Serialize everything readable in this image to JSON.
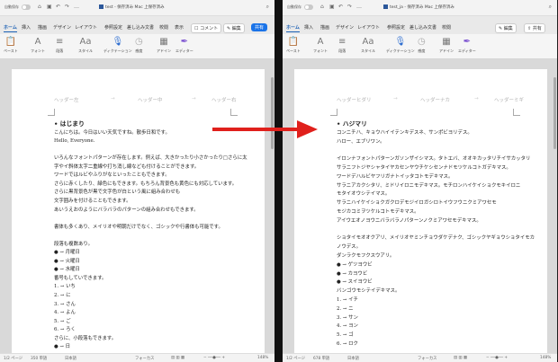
{
  "left_window": {
    "autosave": "自動保存",
    "title": "test - 保存済み Mac 上保存済み",
    "tabs": [
      "ホーム",
      "挿入",
      "描画",
      "デザイン",
      "レイアウト",
      "参照設定",
      "差し込み文書",
      "校閲",
      "表示"
    ],
    "tell_me": "操作アシスト",
    "comment": "コメント",
    "edit": "編集",
    "share": "共有",
    "ribbon": [
      "ペースト",
      "フォント",
      "段落",
      "スタイル",
      "ディクテーション",
      "感度",
      "アドイン",
      "エディター"
    ],
    "header": [
      "ヘッダー左",
      "ヘッダー中",
      "ヘッダー右"
    ],
    "lines": [
      "• はじまり",
      "こんにちは。今日はいい天気ですね。散歩日和です。",
      "Hello, Everyone.",
      "",
      "いろんなフォントパターンが存在します。例えば、大きかったり小さかったり□さらに太",
      "字やイ斜体太字二重線や打ち消し線なども付けることができます。",
      "ワードではルビやふりがなといったこともできます。",
      "さらに赤くしたり、緑色にもできます。もちろん背景色も黄色にも対応しています。",
      "さらに黒背景色が黒で文字色が白という風に組み合わせも",
      "文字囲みを付けることもできます。",
      "あいうえおのようにバラバラのパターンの組み合わせもできます。",
      "",
      "書体も多くあり、メイリオや明朝だけでなく、ゴシックや行書体も可能です。",
      "",
      "段落も複数あり。",
      "● → 月曜日",
      "● → 火曜日",
      "● → 水曜日",
      "番号もしていできます。",
      "1. → いち",
      "2. → に",
      "3. → さん",
      "4. → よん",
      "5. → ご",
      "6. → ろく",
      "さらに、小段落もできます。",
      "● → 日"
    ],
    "status": [
      "1/2 ページ",
      "350 単語",
      "日本語",
      "フォーカス",
      "148%"
    ]
  },
  "right_window": {
    "autosave": "自動保存",
    "title": "test_ja - 保存済み Mac 上保存済み",
    "tabs": [
      "ホーム",
      "挿入",
      "描画",
      "デザイン",
      "レイアウト",
      "参照設定",
      "差し込み文書",
      "校閲"
    ],
    "edit": "編集",
    "share": "共有",
    "ribbon": [
      "ペースト",
      "フォント",
      "段落",
      "スタイル",
      "ディクテーション",
      "感度",
      "アドイン",
      "エディター"
    ],
    "header": [
      "ヘッダーヒダリ",
      "ヘッダーナカ",
      "ヘッダーミギ"
    ],
    "lines": [
      "• ハジマリ",
      "コンニチハ、キョウハイイテンキデスネ、サンポビヨリデス。",
      "ハロー、エブリワン。",
      "",
      "イロンナフォントパターンガソンザイシマス。タトエバ、オオキカッタリチイサカッタリ",
      "サラニフトジヤシャタイヤカセンヤウチケシセンナドモツケルコトガデキマス。",
      "ワードデハルビヤフリガナトイッタコトモデキマス。",
      "サラニアカクシタリ、ミドリイロニモデキマス。モチロンハイケイショクモキイロニ",
      "モタイオウシテイマス。",
      "サラニハイケイショクガクロデモジイロガシロトイウフウニクミアワセモ",
      "モジカコミヲツケルコトモデキマス。",
      "アイウエオノヨウニバラバラノパターンノクミアワセモデキマス。",
      "",
      "ショタイモオオクアリ、メイリオヤミンチョウダケデナク、ゴシックヤギョウショタイモカ",
      "ノウデス。",
      "ダンラクモフクスウアリ。",
      "● → ゲツヨウビ",
      "● → カヨウビ",
      "● → スイヨウビ",
      "バンゴウモシテイデキマス。",
      "1. → イチ",
      "2. → ニ",
      "3. → サン",
      "4. → ヨン",
      "5. → ゴ",
      "6. → ロク"
    ],
    "status": [
      "1/2 ページ",
      "678 単語",
      "日本語",
      "フォーカス",
      "148%"
    ]
  },
  "colors": {
    "arrow": "#e0201c",
    "accent": "#1a5fb4",
    "highlight_yellow": "#ffff00",
    "highlight_blue": "#1020c8",
    "red_text": "#d02020",
    "green_text": "#2a8a2a"
  }
}
